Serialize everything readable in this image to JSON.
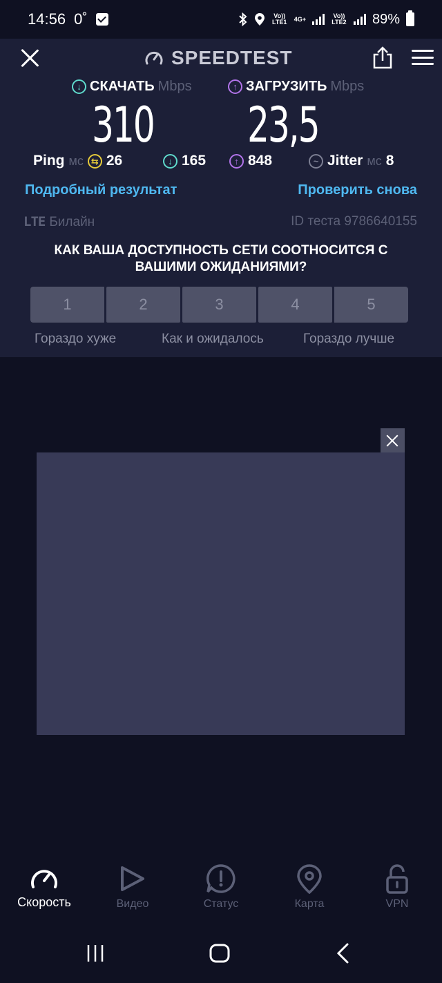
{
  "status_bar": {
    "time": "14:56",
    "temp": "0˚",
    "sim1": "Vo)) LTE1",
    "net": "4G+",
    "sim2": "Vo)) LTE2",
    "battery": "89%"
  },
  "header": {
    "app_title": "SPEEDTEST"
  },
  "results": {
    "download_label": "СКАЧАТЬ",
    "upload_label": "ЗАГРУЗИТЬ",
    "unit": "Mbps",
    "download_value": "310",
    "upload_value": "23,5",
    "ping_label": "Ping",
    "ms_unit": "мс",
    "ping_idle": "26",
    "ping_download": "165",
    "ping_upload": "848",
    "jitter_label": "Jitter",
    "jitter_value": "8"
  },
  "links": {
    "details": "Подробный результат",
    "retest": "Проверить снова"
  },
  "connection": {
    "network_type": "LTE",
    "provider": "Билайн",
    "test_id": "ID теста 9786640155"
  },
  "survey": {
    "question": "КАК ВАША ДОСТУПНОСТЬ СЕТИ СООТНОСИТСЯ С ВАШИМИ ОЖИДАНИЯМИ?",
    "options": [
      "1",
      "2",
      "3",
      "4",
      "5"
    ],
    "label_low": "Гораздо хуже",
    "label_mid": "Как и ожидалось",
    "label_high": "Гораздо лучше"
  },
  "bottom_nav": {
    "items": [
      {
        "label": "Скорость",
        "icon": "speedometer-icon",
        "active": true
      },
      {
        "label": "Видео",
        "icon": "play-icon",
        "active": false
      },
      {
        "label": "Статус",
        "icon": "alert-bubble-icon",
        "active": false
      },
      {
        "label": "Карта",
        "icon": "map-pin-icon",
        "active": false
      },
      {
        "label": "VPN",
        "icon": "lock-open-icon",
        "active": false
      }
    ]
  },
  "colors": {
    "background": "#0f1122",
    "panel": "#1c1f37",
    "download_accent": "#5fdacc",
    "upload_accent": "#b274ea",
    "ping_accent": "#e6cb3a",
    "link": "#4fb8f0"
  }
}
